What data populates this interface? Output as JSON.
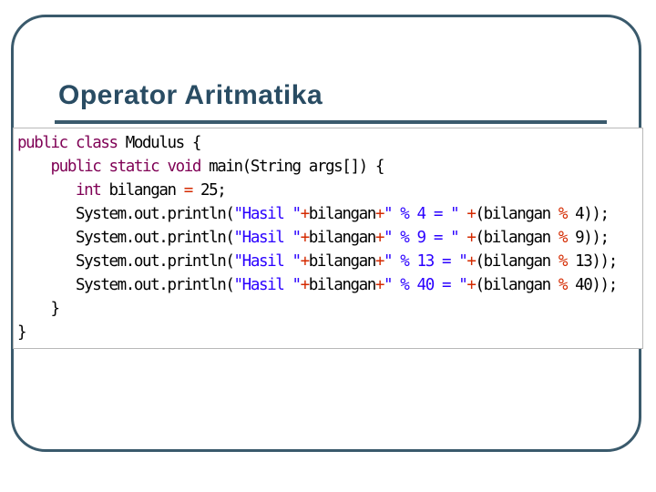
{
  "slide": {
    "title": "Operator Aritmatika"
  },
  "code": {
    "line1": {
      "kw": "public class",
      "txt": " Modulus {"
    },
    "line2": {
      "indent": "    ",
      "kw": "public static void",
      "txt": " main(String args[]) {"
    },
    "line3": {
      "indent": "       ",
      "kw": "int",
      "txt": " bilangan ",
      "op": "=",
      "rest": " 25;"
    },
    "line4": {
      "indent": "       ",
      "a": "System.out.println(",
      "s1": "\"Hasil \"",
      "p1": "+",
      "v": "bilangan",
      "p2": "+",
      "s2": "\" % 4 = \" ",
      "p3": "+",
      "b": "(bilangan ",
      "m": "%",
      "c": " 4));"
    },
    "line5": {
      "indent": "       ",
      "a": "System.out.println(",
      "s1": "\"Hasil \"",
      "p1": "+",
      "v": "bilangan",
      "p2": "+",
      "s2": "\" % 9 = \" ",
      "p3": "+",
      "b": "(bilangan ",
      "m": "%",
      "c": " 9));"
    },
    "line6": {
      "indent": "       ",
      "a": "System.out.println(",
      "s1": "\"Hasil \"",
      "p1": "+",
      "v": "bilangan",
      "p2": "+",
      "s2": "\" % 13 = \"",
      "p3": "+",
      "b": "(bilangan ",
      "m": "%",
      "c": " 13));"
    },
    "line7": {
      "indent": "       ",
      "a": "System.out.println(",
      "s1": "\"Hasil \"",
      "p1": "+",
      "v": "bilangan",
      "p2": "+",
      "s2": "\" % 40 = \"",
      "p3": "+",
      "b": "(bilangan ",
      "m": "%",
      "c": " 40));"
    },
    "line8": {
      "indent": "    ",
      "txt": "}"
    },
    "line9": {
      "txt": "}"
    }
  },
  "colors": {
    "keyword": "#7f0055",
    "string": "#2a00ff",
    "operator": "#d42a00",
    "frame": "#3a5a6c",
    "title": "#294c63"
  }
}
